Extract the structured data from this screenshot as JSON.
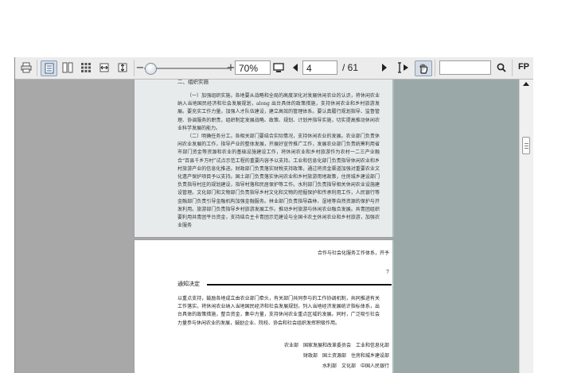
{
  "toolbar": {
    "zoom_value": "70%",
    "page_input": "4",
    "page_separator": "/ 61",
    "search_value": "",
    "fp_label": "FP"
  },
  "doc": {
    "page1_header": "二、组织实施",
    "para1": "（一）加强组织实施。各地要从战略和全局的高度深化对发展休闲农业的认识，将休闲农业纳入当地国民经济和社会发展规划，along 出台具体的政策措施，支持休闲农业和乡村旅游发展。要充实工作力量，加强人才队伍建设，建立高效的管理体系。要认真履行规划指导、监督管理、协调服务的职责，组织制定发展战略、政策、规划、计划并指导实施，切实提高推动休闲农业科学发展的能力。",
    "para2": "（二）明确任务分工。各相关部门要结合实际情况，支持休闲农业的发展。农业部门负责休闲农业发展的工作，指导产业的整体发展，开展好宣传推广工作，发展农业部门负责统筹利用省市部门资金等资源和农业的基础设施建设工作，将休闲农业和乡村旅游作为农村一二三产业融合“百县千乡万村”试点示范工程的重要内容予以支持。工业和信息化部门负责指导休闲农业和乡村旅游产业的信息化推进。财政部门负责落实财税支持政策，通过将资金渠道加强对重要农业文化遗产保护项目予以支持。国土部门负责落实休闲农业和乡村旅游用地政策，住房城乡建设部门负责指导村庄的规划建设，指导村落和民居保护等工作。水利部门负责指导相关休闲农业设施建设管理。文化部门和文物部门负责指导乡村文化和文物的挖掘保护和传承利用工作，人民银行等金融部门负责引导金融机构加强金融服务。林业部门负责指导森林、湿地等自然资源的保护与开发利用。旅游部门负责指导乡村旅游发展工作。推动乡村旅游与休闲农业融合发展。共青团组织要利用共青团平台资金，支持结合主卡青团示范建设与全国卡农主休闲农业和乡村旅游，加强农业服务",
    "page2_top_right": "合作与社会化服务工作体系，开予",
    "page2_page_number": "7",
    "notice_title": "通知决定",
    "para3": "以重点支持，鼓励各地成立由农业部门牵头，有关部门共同参与的工作协调机制，共同推进有关工作落实。将休闲农业纳入当地国民经济和社会发展规划，列入当地经济发展统计指标体系，出台具体的政策措施，整合资金，集中力量，支持休闲农业重点区域的发展。同时，广泛吸引社会力量参与休闲农业的发展，鼓励企业、院校、协会和社会组织发挥积极作用。",
    "sign_line1": "农业部　国家发展和改革委员会　工业和信息化部",
    "sign_line2": "财政部　国土资源部　住房和城乡建设部",
    "sign_line3": "水利部　文化部　中国人民银行"
  }
}
